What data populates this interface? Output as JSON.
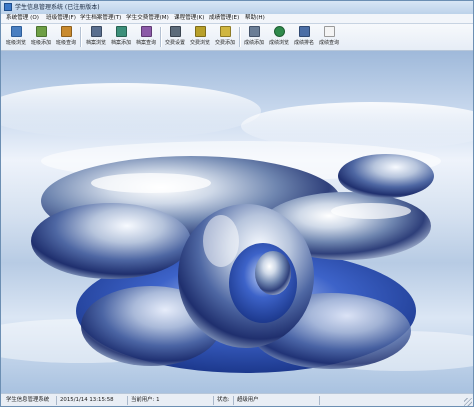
{
  "window": {
    "title": "学生信息管理系统 (已注册版本)"
  },
  "menu": [
    {
      "label": "系统管理 (O)"
    },
    {
      "label": "班级管理(F)"
    },
    {
      "label": "学生档案管理(T)"
    },
    {
      "label": "学生交费管理(M)"
    },
    {
      "label": "课程管理(K)"
    },
    {
      "label": "成绩管理(E)"
    },
    {
      "label": "帮助(H)"
    }
  ],
  "toolbar": [
    {
      "label": "班级浏览",
      "icon": "class-browse-icon",
      "color": "#4a7fc1"
    },
    {
      "label": "班级添加",
      "icon": "class-add-icon",
      "color": "#6e9f45"
    },
    {
      "label": "班级查询",
      "icon": "class-query-icon",
      "color": "#c98a2e"
    },
    {
      "label": "档案浏览",
      "icon": "archive-browse-icon",
      "color": "#5a6f8f"
    },
    {
      "label": "档案添加",
      "icon": "archive-add-icon",
      "color": "#3c8f7a"
    },
    {
      "label": "档案查询",
      "icon": "archive-query-icon",
      "color": "#8c5aa8"
    },
    {
      "label": "交费设置",
      "icon": "fee-settings-icon",
      "color": "#5c6b7a"
    },
    {
      "label": "交费浏览",
      "icon": "fee-browse-icon",
      "color": "#b8a02a"
    },
    {
      "label": "交费添加",
      "icon": "fee-add-icon",
      "color": "#d0b640"
    },
    {
      "label": "成绩添加",
      "icon": "grade-add-icon",
      "color": "#6a7d96"
    },
    {
      "label": "成绩浏览",
      "icon": "grade-browse-icon",
      "color": "#2f8a4b"
    },
    {
      "label": "成绩排名",
      "icon": "grade-rank-icon",
      "color": "#4b6ea6"
    },
    {
      "label": "成绩查询",
      "icon": "grade-query-icon",
      "color": "#9a9a9a"
    }
  ],
  "status": {
    "app": "学生信息管理系统",
    "datetime": "2015/1/14 13:15:58",
    "current_user_label": "当前用户: 1",
    "state": "状态:",
    "user_role": "超级用户"
  }
}
